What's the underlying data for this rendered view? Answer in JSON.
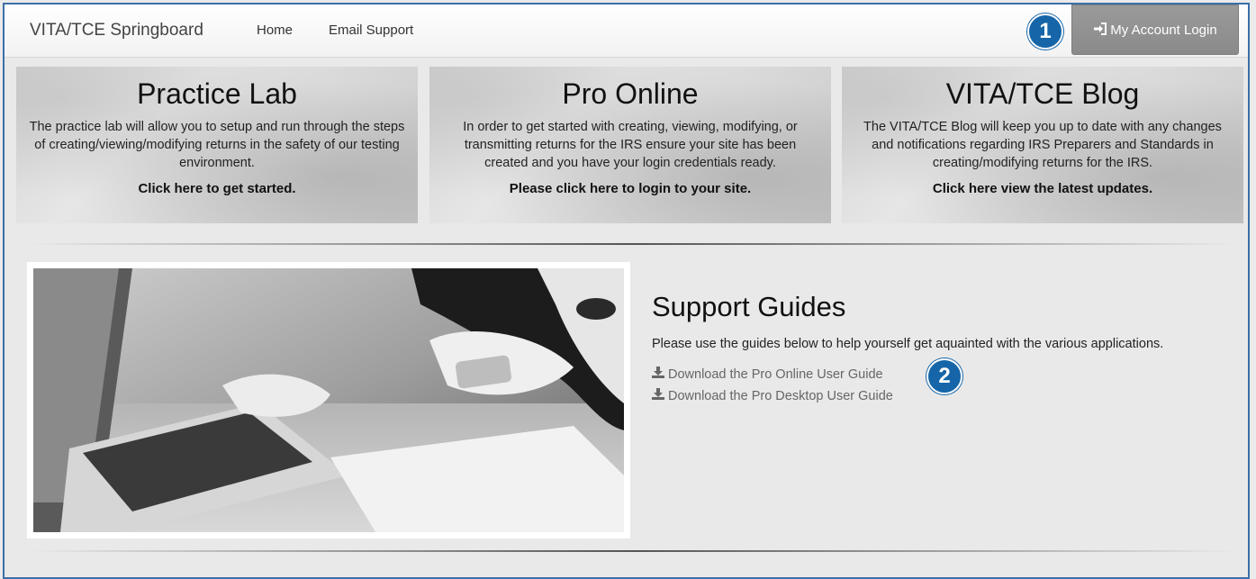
{
  "navbar": {
    "brand": "VITA/TCE Springboard",
    "links": [
      "Home",
      "Email Support"
    ],
    "login_label": "My Account Login"
  },
  "badges": [
    "1",
    "2"
  ],
  "tiles": [
    {
      "title": "Practice Lab",
      "description": "The practice lab will allow you to setup and run through the steps of creating/viewing/modifying returns in the safety of our testing environment.",
      "cta": "Click here to get started."
    },
    {
      "title": "Pro Online",
      "description": "In order to get started with creating, viewing, modifying, or transmitting returns for the IRS ensure your site has been created and you have your login credentials ready.",
      "cta": "Please click here to login to your site."
    },
    {
      "title": "VITA/TCE Blog",
      "description": "The VITA/TCE Blog will keep you up to date with any changes and notifications regarding IRS Preparers and Standards in creating/modifying returns for the IRS.",
      "cta": "Click here view the latest updates."
    }
  ],
  "support": {
    "title": "Support Guides",
    "description": "Please use the guides below to help yourself get aquainted with the various applications.",
    "links": [
      "Download the Pro Online User Guide",
      "Download the Pro Desktop User Guide"
    ]
  },
  "icons": {
    "login": "sign-in-icon",
    "download": "download-icon"
  },
  "colors": {
    "badge": "#1565a8",
    "login_button": "#8f8f8f",
    "frame_border": "#3b6fa8"
  }
}
